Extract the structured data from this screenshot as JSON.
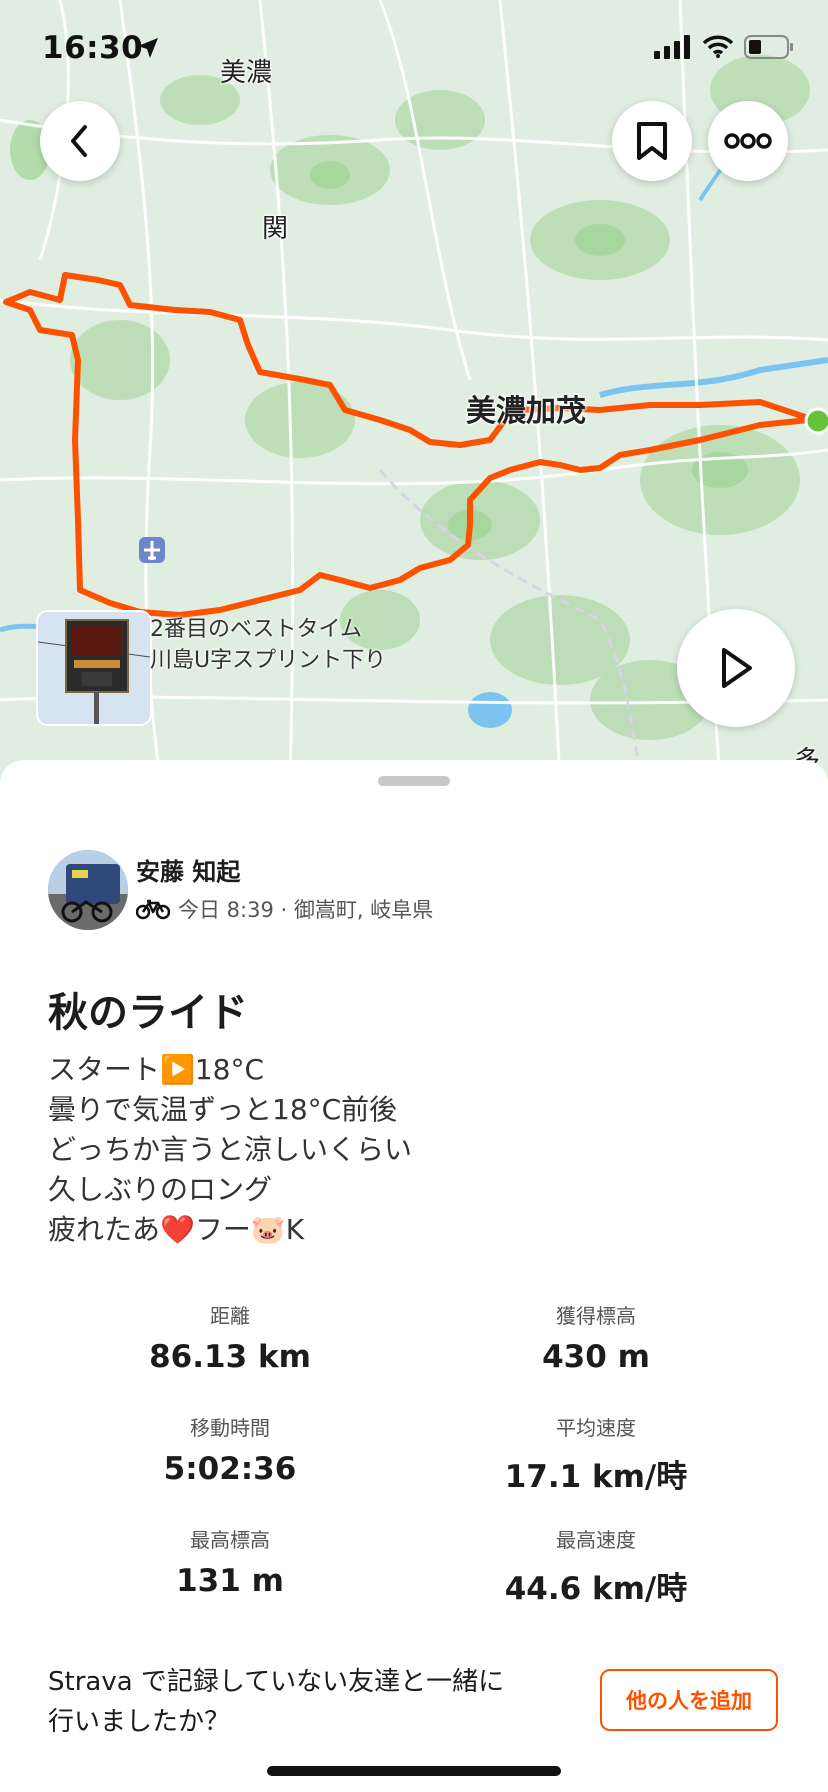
{
  "status_bar": {
    "time": "16:30"
  },
  "map": {
    "labels": {
      "mino": "美濃",
      "seki": "関",
      "minokamo": "美濃加茂",
      "edge": "多"
    },
    "segment": {
      "line1": "2番目のベストタイム",
      "line2": "川島U字スプリント下り"
    },
    "colors": {
      "route": "#fc5200",
      "end_marker": "#66c43a"
    },
    "icons": {
      "back": "chevron-left-icon",
      "bookmark": "bookmark-icon",
      "more": "more-horizontal-icon",
      "play": "play-icon",
      "airport": "airport-icon"
    }
  },
  "activity": {
    "athlete_name": "安藤 知起",
    "meta": "今日 8:39 · 御嵩町, 岐阜県",
    "title": "秋のライド",
    "description": [
      "スタート▶️18°C",
      "曇りで気温ずっと18°C前後",
      "どっちか言うと涼しいくらい",
      "久しぶりのロング",
      "疲れたあ❤️フー🐷K"
    ]
  },
  "stats": [
    {
      "label": "距離",
      "value": "86.13 km"
    },
    {
      "label": "獲得標高",
      "value": "430 m"
    },
    {
      "label": "移動時間",
      "value": "5:02:36"
    },
    {
      "label": "平均速度",
      "value": "17.1 km/時"
    },
    {
      "label": "最高標高",
      "value": "131 m"
    },
    {
      "label": "最高速度",
      "value": "44.6 km/時"
    }
  ],
  "friends_prompt": {
    "line1": "Strava で記録していない友達と一緒に",
    "line2": "行いましたか？",
    "button": "他の人を追加"
  },
  "accent_color": "#fc5200"
}
